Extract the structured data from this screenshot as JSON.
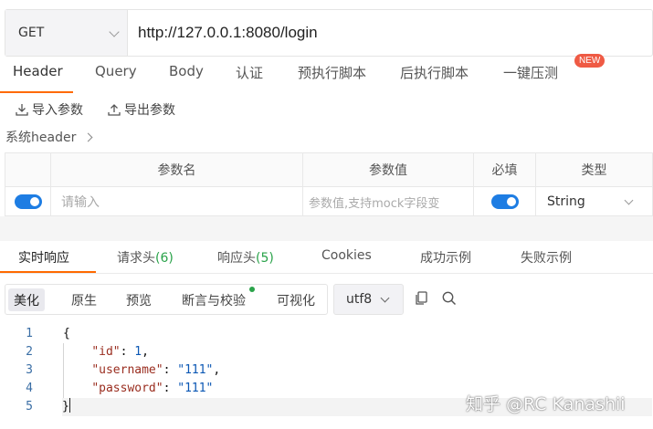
{
  "request": {
    "method": "GET",
    "url": "http://127.0.0.1:8080/login"
  },
  "request_tabs": [
    "Header",
    "Query",
    "Body",
    "认证",
    "预执行脚本",
    "后执行脚本",
    "一键压测"
  ],
  "new_badge": "NEW",
  "actions": {
    "import_label": "导入参数",
    "export_label": "导出参数"
  },
  "system_header": "系统header",
  "param_table": {
    "headers": [
      "参数名",
      "参数值",
      "必填",
      "类型"
    ],
    "row": {
      "enabled": true,
      "name_placeholder": "请输入",
      "value_placeholder": "参数值,支持mock字段变",
      "required": true,
      "type": "String"
    }
  },
  "response_tabs": [
    {
      "label": "实时响应",
      "count": ""
    },
    {
      "label": "请求头",
      "count": "(6)"
    },
    {
      "label": "响应头",
      "count": "(5)"
    },
    {
      "label": "Cookies",
      "count": ""
    },
    {
      "label": "成功示例",
      "count": ""
    },
    {
      "label": "失败示例",
      "count": ""
    }
  ],
  "view_modes": [
    "美化",
    "原生",
    "预览",
    "断言与校验",
    "可视化"
  ],
  "encoding": "utf8",
  "code_lines": [
    {
      "num": "1",
      "text": "{"
    },
    {
      "num": "2",
      "key": "\"id\"",
      "value": "1",
      "trail": ","
    },
    {
      "num": "3",
      "key": "\"username\"",
      "value": "\"111\"",
      "trail": ","
    },
    {
      "num": "4",
      "key": "\"password\"",
      "value": "\"111\"",
      "trail": ""
    },
    {
      "num": "5",
      "text": "}"
    }
  ],
  "watermark": "知乎 @RC Kanashii",
  "colors": {
    "accent": "#ff6a00",
    "toggle": "#1e7de3",
    "count_green": "#2aa34a",
    "badge_red": "#ef5a44"
  }
}
